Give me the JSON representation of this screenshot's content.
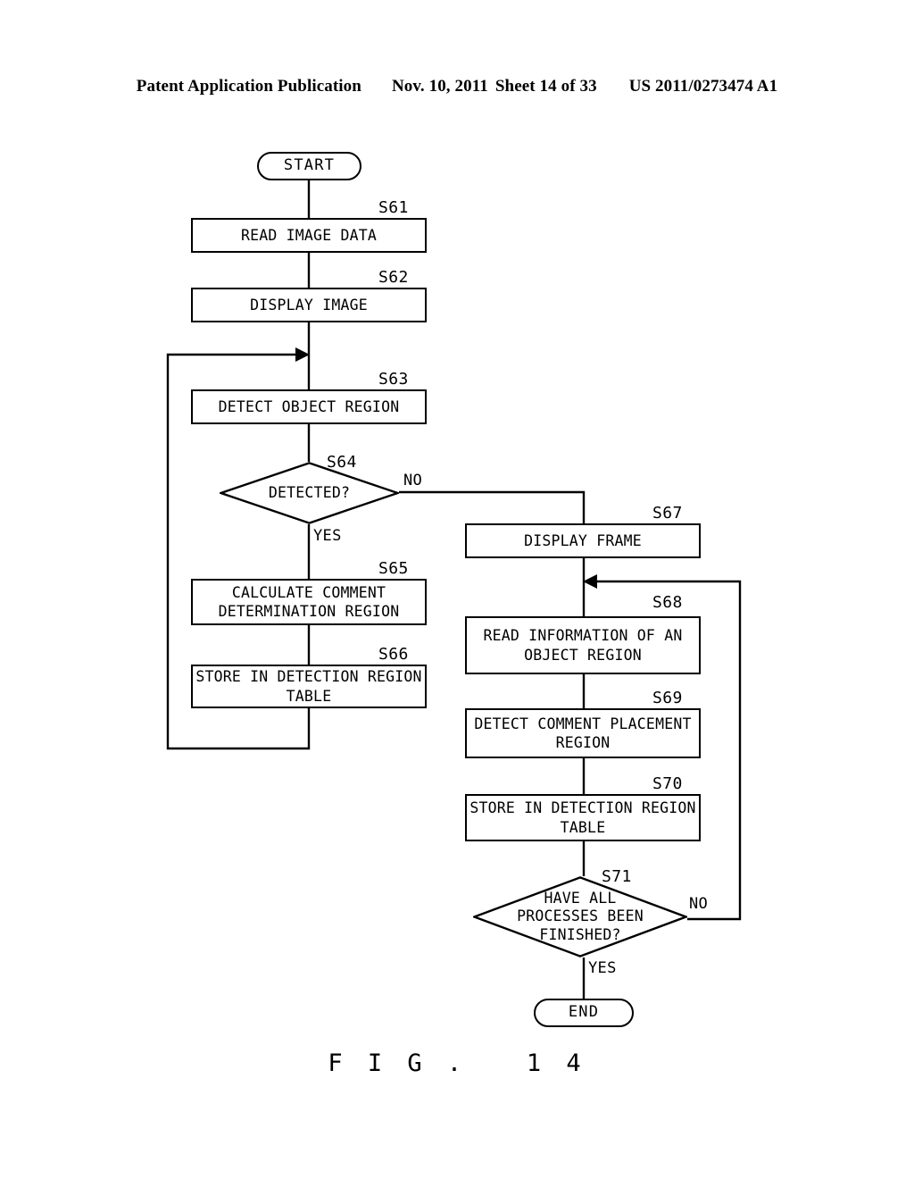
{
  "header": {
    "publication": "Patent Application Publication",
    "date": "Nov. 10, 2011",
    "sheet": "Sheet 14 of 33",
    "number": "US 2011/0273474 A1"
  },
  "figure": {
    "caption": "F I G .   1 4"
  },
  "flowchart": {
    "type": "flowchart",
    "nodes": [
      {
        "id": "start",
        "shape": "terminal",
        "label": "START"
      },
      {
        "id": "s61",
        "shape": "process",
        "step": "S61",
        "label": "READ IMAGE DATA"
      },
      {
        "id": "s62",
        "shape": "process",
        "step": "S62",
        "label": "DISPLAY IMAGE"
      },
      {
        "id": "s63",
        "shape": "process",
        "step": "S63",
        "label": "DETECT OBJECT REGION"
      },
      {
        "id": "s64",
        "shape": "decision",
        "step": "S64",
        "label": "DETECTED?"
      },
      {
        "id": "s65",
        "shape": "process",
        "step": "S65",
        "label": "CALCULATE COMMENT\nDETERMINATION REGION"
      },
      {
        "id": "s66",
        "shape": "process",
        "step": "S66",
        "label": "STORE IN DETECTION REGION\nTABLE"
      },
      {
        "id": "s67",
        "shape": "process",
        "step": "S67",
        "label": "DISPLAY FRAME"
      },
      {
        "id": "s68",
        "shape": "process",
        "step": "S68",
        "label": "READ INFORMATION OF AN\nOBJECT REGION"
      },
      {
        "id": "s69",
        "shape": "process",
        "step": "S69",
        "label": "DETECT COMMENT PLACEMENT\nREGION"
      },
      {
        "id": "s70",
        "shape": "process",
        "step": "S70",
        "label": "STORE IN DETECTION REGION\nTABLE"
      },
      {
        "id": "s71",
        "shape": "decision",
        "step": "S71",
        "label": "HAVE ALL\nPROCESSES BEEN\nFINISHED?"
      },
      {
        "id": "end",
        "shape": "terminal",
        "label": "END"
      }
    ],
    "branch_labels": {
      "s64_no": "NO",
      "s64_yes": "YES",
      "s71_no": "NO",
      "s71_yes": "YES"
    },
    "edges": [
      {
        "from": "start",
        "to": "s61"
      },
      {
        "from": "s61",
        "to": "s62"
      },
      {
        "from": "s62",
        "to": "s63"
      },
      {
        "from": "s63",
        "to": "s64"
      },
      {
        "from": "s64",
        "to": "s65",
        "label": "YES"
      },
      {
        "from": "s64",
        "to": "s67",
        "label": "NO"
      },
      {
        "from": "s65",
        "to": "s66"
      },
      {
        "from": "s66",
        "to": "s63",
        "note": "loop back"
      },
      {
        "from": "s67",
        "to": "s68"
      },
      {
        "from": "s68",
        "to": "s69"
      },
      {
        "from": "s69",
        "to": "s70"
      },
      {
        "from": "s70",
        "to": "s71"
      },
      {
        "from": "s71",
        "to": "s68",
        "label": "NO",
        "note": "loop back"
      },
      {
        "from": "s71",
        "to": "end",
        "label": "YES"
      }
    ],
    "colors": {
      "line": "#000000",
      "fill": "#ffffff"
    }
  }
}
